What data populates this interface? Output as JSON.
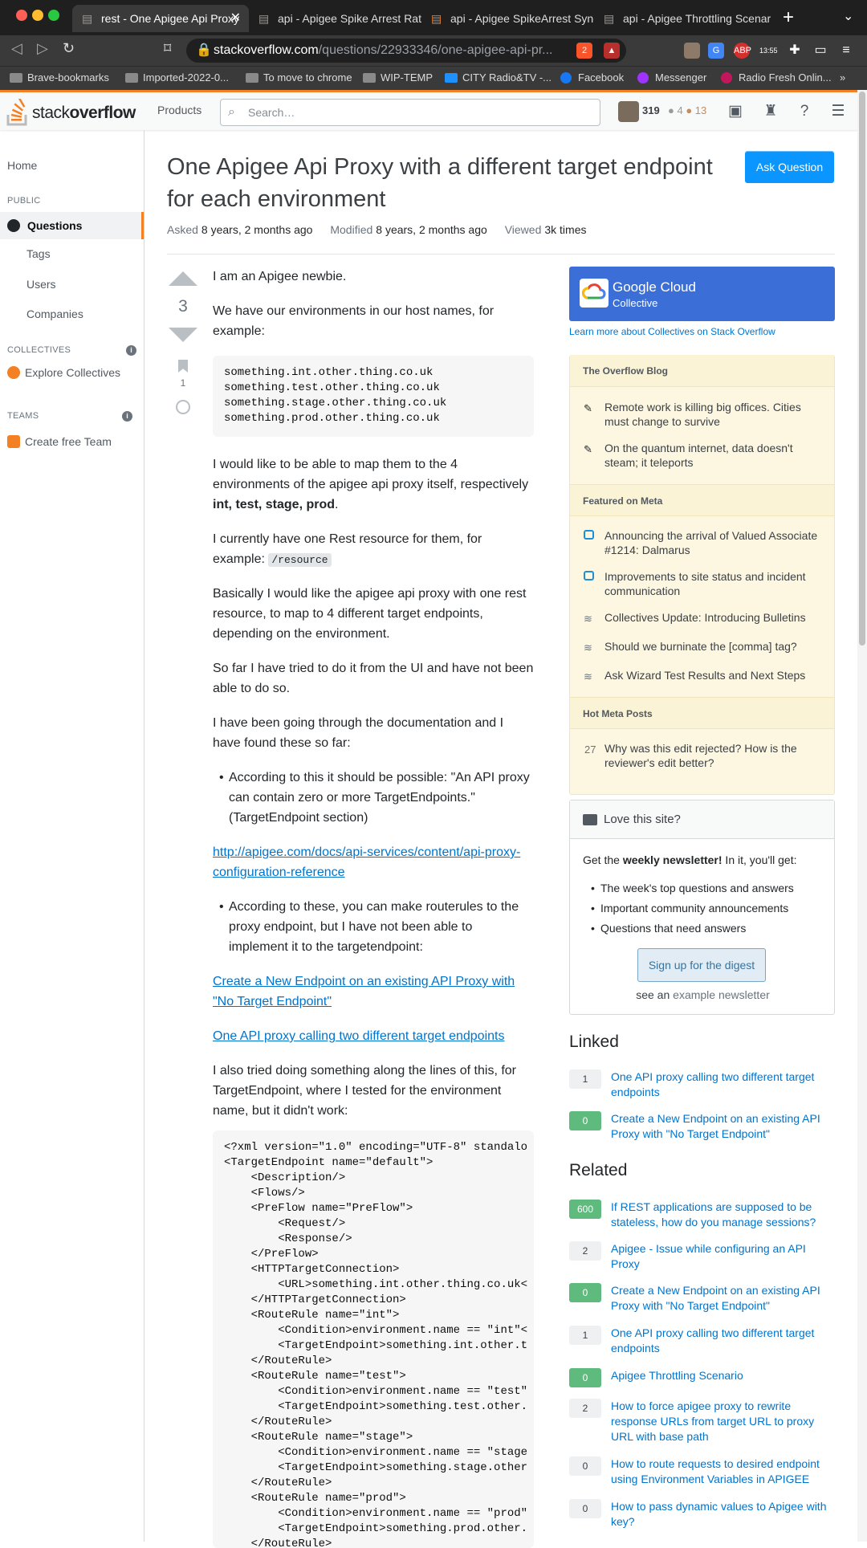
{
  "browser": {
    "tabs": [
      {
        "label": "rest - One Apigee Api Proxy",
        "active": true
      },
      {
        "label": "api - Apigee Spike Arrest Rate L",
        "active": false
      },
      {
        "label": "api - Apigee SpikeArrest Sync A",
        "active": false
      },
      {
        "label": "api - Apigee Throttling Scenario",
        "active": false
      }
    ],
    "url_host": "stackoverflow.com",
    "url_path": "/questions/22933346/one-apigee-api-pr...",
    "ext_badge_brave": "2",
    "bookmarks": [
      "Brave-bookmarks",
      "Imported-2022-0...",
      "To move to chrome",
      "WIP-TEMP",
      "CITY Radio&TV -...",
      "Facebook",
      "Messenger",
      "Radio Fresh Onlin..."
    ]
  },
  "so_header": {
    "logo_a": "stack",
    "logo_b": "overflow",
    "products": "Products",
    "search_placeholder": "Search…",
    "reputation": "319",
    "silver": "● 4",
    "bronze": "● 13"
  },
  "leftnav": {
    "home": "Home",
    "public": "PUBLIC",
    "questions": "Questions",
    "tags": "Tags",
    "users": "Users",
    "companies": "Companies",
    "collectives": "COLLECTIVES",
    "explore": "Explore Collectives",
    "teams": "TEAMS",
    "create_team": "Create free Team"
  },
  "question": {
    "title": "One Apigee Api Proxy with a different target endpoint for each environment",
    "ask_button": "Ask Question",
    "asked_label": "Asked",
    "asked_value": "8 years, 2 months ago",
    "modified_label": "Modified",
    "modified_value": "8 years, 2 months ago",
    "viewed_label": "Viewed",
    "viewed_value": "3k times",
    "votes": "3",
    "bookmarks": "1",
    "p1": "I am an Apigee newbie.",
    "p2": "We have our environments in our host names, for example:",
    "code1": "something.int.other.thing.co.uk\nsomething.test.other.thing.co.uk\nsomething.stage.other.thing.co.uk\nsomething.prod.other.thing.co.uk",
    "p3a": "I would like to be able to map them to the 4 environments of the apigee api proxy itself, respectively ",
    "p3b": "int, test, stage, prod",
    "p3c": ".",
    "p4a": "I currently have one Rest resource for them, for example: ",
    "p4code": "/resource",
    "p5": "Basically I would like the apigee api proxy with one rest resource, to map to 4 different target endpoints, depending on the environment.",
    "p6": "So far I have tried to do it from the UI and have not been able to do so.",
    "p7": "I have been going through the documentation and I have found these so far:",
    "li1": "According to this it should be possible: \"An API proxy can contain zero or more TargetEndpoints.\" (TargetEndpoint section)",
    "link1": "http://apigee.com/docs/api-services/content/api-proxy-configuration-reference",
    "li2": "According to these, you can make routerules to the proxy endpoint, but I have not been able to implement it to the targetendpoint:",
    "link2": "Create a New Endpoint on an existing API Proxy with \"No Target Endpoint\"",
    "link3": "One API proxy calling two different target endpoints",
    "p8": "I also tried doing something along the lines of this, for TargetEndpoint, where I tested for the environment name, but it didn't work:",
    "code2": "<?xml version=\"1.0\" encoding=\"UTF-8\" standalo\n<TargetEndpoint name=\"default\">\n    <Description/>\n    <Flows/>\n    <PreFlow name=\"PreFlow\">\n        <Request/>\n        <Response/>\n    </PreFlow>\n    <HTTPTargetConnection>\n        <URL>something.int.other.thing.co.uk<\n    </HTTPTargetConnection>\n    <RouteRule name=\"int\">\n        <Condition>environment.name == \"int\"<\n        <TargetEndpoint>something.int.other.t\n    </RouteRule>\n    <RouteRule name=\"test\">\n        <Condition>environment.name == \"test\"\n        <TargetEndpoint>something.test.other.\n    </RouteRule>\n    <RouteRule name=\"stage\">\n        <Condition>environment.name == \"stage\n        <TargetEndpoint>something.stage.other\n    </RouteRule>\n    <RouteRule name=\"prod\">\n        <Condition>environment.name == \"prod\"\n        <TargetEndpoint>something.prod.other.\n    </RouteRule>"
  },
  "sidebar": {
    "gc_title": "Google Cloud",
    "gc_sub": "Collective",
    "learn_more": "Learn more about Collectives on Stack Overflow",
    "blog_head": "The Overflow Blog",
    "blog": [
      "Remote work is killing big offices. Cities must change to survive",
      "On the quantum internet, data doesn't steam; it teleports"
    ],
    "meta_head": "Featured on Meta",
    "meta": [
      "Announcing the arrival of Valued Associate #1214: Dalmarus",
      "Improvements to site status and incident communication",
      "Collectives Update: Introducing Bulletins",
      "Should we burninate the [comma] tag?",
      "Ask Wizard Test Results and Next Steps"
    ],
    "hot_head": "Hot Meta Posts",
    "hot_count": "27",
    "hot": "Why was this edit rejected? How is the reviewer's edit better?",
    "love_head": "Love this site?",
    "love_a": "Get the ",
    "love_b": "weekly newsletter!",
    "love_c": " In it, you'll get:",
    "love_items": [
      "The week's top questions and answers",
      "Important community announcements",
      "Questions that need answers"
    ],
    "digest": "Sign up for the digest",
    "see_an": "see an ",
    "example": "example newsletter",
    "linked_head": "Linked",
    "linked": [
      {
        "count": "1",
        "accepted": false,
        "title": "One API proxy calling two different target endpoints"
      },
      {
        "count": "0",
        "accepted": true,
        "title": "Create a New Endpoint on an existing API Proxy with \"No Target Endpoint\""
      }
    ],
    "related_head": "Related",
    "related": [
      {
        "count": "600",
        "accepted": true,
        "title": "If REST applications are supposed to be stateless, how do you manage sessions?"
      },
      {
        "count": "2",
        "accepted": false,
        "title": "Apigee - Issue while configuring an API Proxy"
      },
      {
        "count": "0",
        "accepted": true,
        "title": "Create a New Endpoint on an existing API Proxy with \"No Target Endpoint\""
      },
      {
        "count": "1",
        "accepted": false,
        "title": "One API proxy calling two different target endpoints"
      },
      {
        "count": "0",
        "accepted": true,
        "title": "Apigee Throttling Scenario"
      },
      {
        "count": "2",
        "accepted": false,
        "title": "How to force apigee proxy to rewrite response URLs from target URL to proxy URL with base path"
      },
      {
        "count": "0",
        "accepted": false,
        "title": "How to route requests to desired endpoint using Environment Variables in APIGEE"
      },
      {
        "count": "0",
        "accepted": false,
        "title": "How to pass dynamic values to Apigee with key?"
      }
    ]
  }
}
